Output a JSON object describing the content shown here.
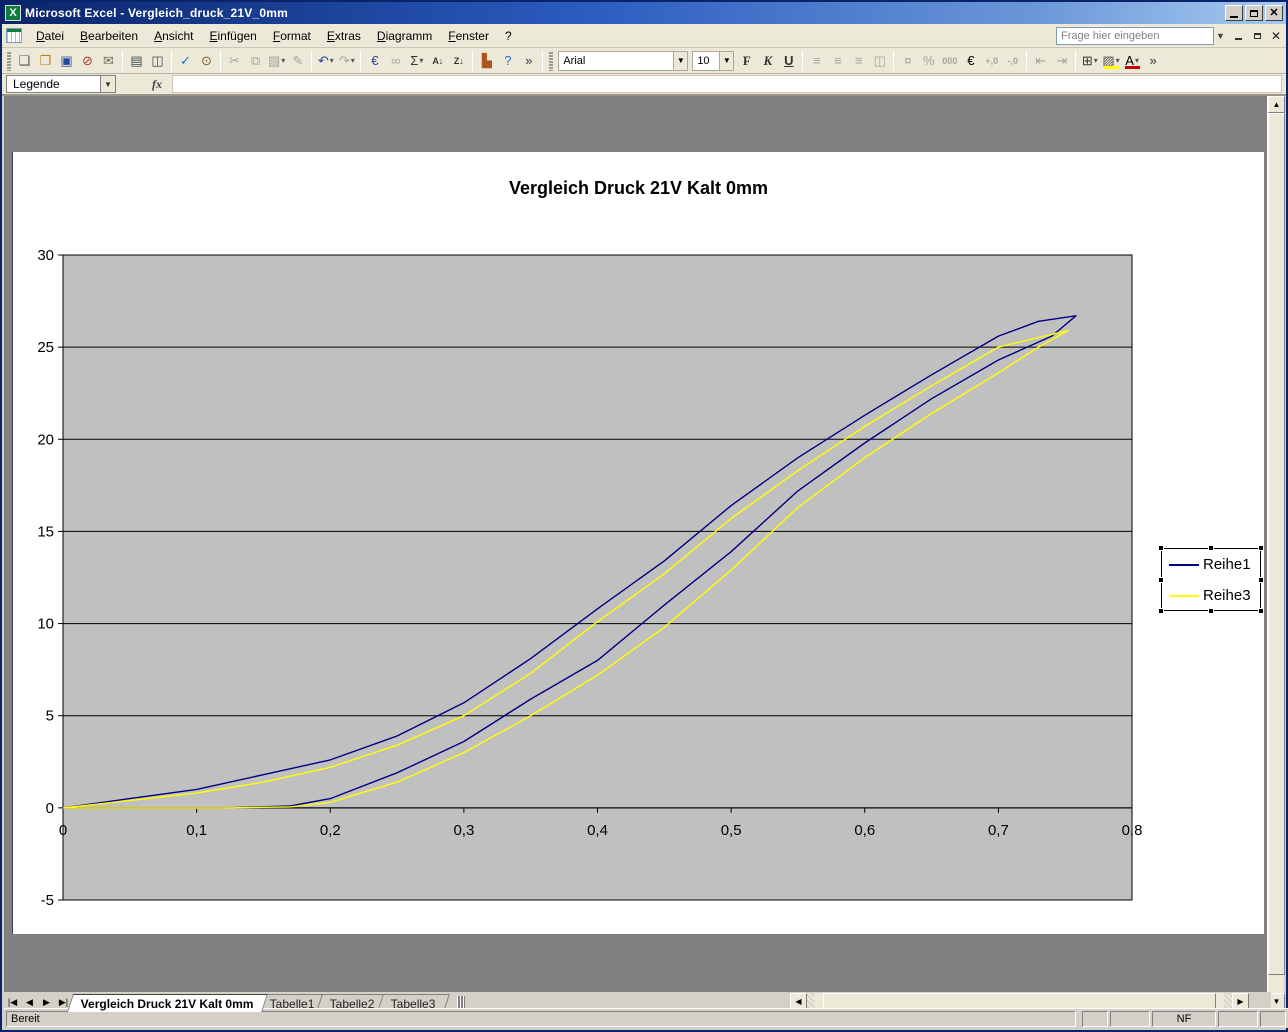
{
  "titlebar": {
    "title": "Microsoft Excel - Vergleich_druck_21V_0mm"
  },
  "menubar": {
    "items": [
      "Datei",
      "Bearbeiten",
      "Ansicht",
      "Einfügen",
      "Format",
      "Extras",
      "Diagramm",
      "Fenster",
      "?"
    ],
    "question_placeholder": "Frage hier eingeben"
  },
  "standard_toolbar": {
    "buttons": [
      {
        "name": "new-button",
        "glyph": "❑",
        "color": "#555"
      },
      {
        "name": "open-button",
        "glyph": "❒",
        "color": "#b8860b"
      },
      {
        "name": "save-button",
        "glyph": "▣",
        "color": "#23479e"
      },
      {
        "name": "permission-button",
        "glyph": "⊘",
        "color": "#b03030"
      },
      {
        "name": "mail-button",
        "glyph": "✉",
        "color": "#6b6b5a"
      },
      {
        "name": "print-button",
        "glyph": "▤",
        "color": "#3c4d5a",
        "sep": true
      },
      {
        "name": "print-preview-button",
        "glyph": "◫",
        "color": "#3c4d5a"
      },
      {
        "name": "spelling-button",
        "glyph": "✓",
        "color": "#1f6fc0",
        "sep": true
      },
      {
        "name": "research-button",
        "glyph": "⊙",
        "color": "#7a5c28"
      },
      {
        "name": "cut-button",
        "glyph": "✂",
        "dim": true,
        "sep": true
      },
      {
        "name": "copy-button",
        "glyph": "⧉",
        "dim": true
      },
      {
        "name": "paste-button",
        "glyph": "▨",
        "dim": true,
        "dropdown": true
      },
      {
        "name": "format-painter-button",
        "glyph": "✎",
        "dim": true
      },
      {
        "name": "undo-button",
        "glyph": "↶",
        "color": "#23479e",
        "dropdown": true,
        "sep": true
      },
      {
        "name": "redo-button",
        "glyph": "↷",
        "dim": true,
        "dropdown": true
      },
      {
        "name": "euro-convert-button",
        "glyph": "€",
        "color": "#23479e",
        "sep": true
      },
      {
        "name": "hyperlink-button",
        "glyph": "∞",
        "dim": true
      },
      {
        "name": "autosum-button",
        "glyph": "Σ",
        "color": "#333",
        "dropdown": true
      },
      {
        "name": "sort-ascending-button",
        "glyph": "A↓",
        "small": true,
        "color": "#333"
      },
      {
        "name": "sort-descending-button",
        "glyph": "Z↓",
        "small": true,
        "color": "#333"
      },
      {
        "name": "chart-wizard-button",
        "glyph": "▙",
        "color": "#b0541e",
        "sep": true
      },
      {
        "name": "help-button",
        "glyph": "?",
        "color": "#1f6fc0"
      },
      {
        "name": "toolbar-options-button",
        "glyph": "»",
        "color": "#333"
      }
    ]
  },
  "formatting_toolbar": {
    "font_name": "Arial",
    "font_size": "10",
    "buttons": [
      {
        "name": "bold-button",
        "glyph": "F",
        "cls": "fmt-b"
      },
      {
        "name": "italic-button",
        "glyph": "K",
        "cls": "fmt-i"
      },
      {
        "name": "underline-button",
        "glyph": "U",
        "cls": "fmt-u"
      },
      {
        "name": "align-left-button",
        "glyph": "≡",
        "dim": true,
        "sep": true
      },
      {
        "name": "align-center-button",
        "glyph": "≡",
        "dim": true
      },
      {
        "name": "align-right-button",
        "glyph": "≡",
        "dim": true
      },
      {
        "name": "merge-center-button",
        "glyph": "◫",
        "dim": true
      },
      {
        "name": "currency-button",
        "glyph": "¤",
        "dim": true,
        "sep": true
      },
      {
        "name": "percent-button",
        "glyph": "%",
        "dim": true
      },
      {
        "name": "thousands-button",
        "glyph": "000",
        "small": true,
        "dim": true
      },
      {
        "name": "euro-button",
        "glyph": "€",
        "color": "#000"
      },
      {
        "name": "increase-decimal-button",
        "glyph": "+,0",
        "small": true,
        "dim": true
      },
      {
        "name": "decrease-decimal-button",
        "glyph": "-,0",
        "small": true,
        "dim": true
      },
      {
        "name": "decrease-indent-button",
        "glyph": "⇤",
        "dim": true,
        "sep": true
      },
      {
        "name": "increase-indent-button",
        "glyph": "⇥",
        "dim": true
      },
      {
        "name": "borders-button",
        "glyph": "⊞",
        "color": "#333",
        "dropdown": true,
        "sep": true
      },
      {
        "name": "fill-color-button",
        "glyph": "▨",
        "color": "#555",
        "cls": "bar-fill",
        "dropdown": true
      },
      {
        "name": "font-color-button",
        "glyph": "A",
        "color": "#000",
        "cls": "bar-fcol",
        "dropdown": true
      },
      {
        "name": "toolbar-options2-button",
        "glyph": "»",
        "color": "#333"
      }
    ]
  },
  "formula_bar": {
    "name_box": "Legende",
    "fx_label": "fx",
    "formula_value": ""
  },
  "chart_data": {
    "type": "line",
    "title": "Vergleich Druck 21V Kalt 0mm",
    "xlabel": "",
    "ylabel": "",
    "xlim": [
      0,
      0.8
    ],
    "ylim": [
      -5,
      30
    ],
    "grid": "horizontal",
    "legend_position": "right",
    "plot_bg": "#C0C0C0",
    "xticks": {
      "values": [
        0,
        0.1,
        0.2,
        0.3,
        0.4,
        0.5,
        0.6,
        0.7,
        0.8
      ],
      "labels": [
        "0",
        "0,1",
        "0,2",
        "0,3",
        "0,4",
        "0,5",
        "0,6",
        "0,7",
        "0,8"
      ]
    },
    "yticks": {
      "values": [
        30,
        25,
        20,
        15,
        10,
        5,
        0,
        -5
      ],
      "labels": [
        "30",
        "25",
        "20",
        "15",
        "10",
        "5",
        "0",
        "-5"
      ]
    },
    "series": [
      {
        "name": "Reihe1",
        "color": "#000080",
        "x": [
          0,
          0.05,
          0.1,
          0.15,
          0.2,
          0.25,
          0.3,
          0.35,
          0.4,
          0.45,
          0.5,
          0.55,
          0.6,
          0.65,
          0.7,
          0.73,
          0.758,
          0.74,
          0.7,
          0.65,
          0.6,
          0.55,
          0.5,
          0.45,
          0.4,
          0.35,
          0.3,
          0.25,
          0.2,
          0.17,
          0.12,
          0.05,
          0
        ],
        "y": [
          0,
          0.5,
          1.0,
          1.8,
          2.6,
          3.9,
          5.7,
          8.1,
          10.8,
          13.4,
          16.4,
          19.0,
          21.3,
          23.5,
          25.6,
          26.4,
          26.7,
          25.6,
          24.3,
          22.2,
          19.8,
          17.2,
          13.9,
          11.0,
          8.0,
          5.9,
          3.6,
          1.9,
          0.5,
          0.1,
          0,
          0,
          0
        ]
      },
      {
        "name": "Reihe3",
        "color": "#FFFF00",
        "x": [
          0,
          0.05,
          0.1,
          0.15,
          0.2,
          0.25,
          0.3,
          0.35,
          0.4,
          0.45,
          0.5,
          0.55,
          0.6,
          0.65,
          0.7,
          0.752,
          0.73,
          0.7,
          0.65,
          0.6,
          0.55,
          0.5,
          0.45,
          0.4,
          0.35,
          0.3,
          0.25,
          0.2,
          0.17,
          0.12,
          0.05,
          0
        ],
        "y": [
          0,
          0.4,
          0.8,
          1.4,
          2.2,
          3.4,
          5.0,
          7.3,
          10.1,
          12.7,
          15.7,
          18.3,
          20.7,
          22.9,
          25.0,
          25.9,
          25.0,
          23.6,
          21.4,
          19.0,
          16.3,
          12.9,
          9.8,
          7.2,
          5.0,
          3.0,
          1.4,
          0.3,
          0.05,
          0,
          0,
          0
        ]
      }
    ]
  },
  "sheet_tabs": {
    "nav": [
      "|◀",
      "◀",
      "▶",
      "▶|"
    ],
    "tabs": [
      {
        "label": "Vergleich Druck 21V Kalt 0mm",
        "active": true
      },
      {
        "label": "Tabelle1",
        "active": false
      },
      {
        "label": "Tabelle2",
        "active": false
      },
      {
        "label": "Tabelle3",
        "active": false
      }
    ]
  },
  "status_bar": {
    "mode": "Bereit",
    "panels": [
      "",
      "",
      "NF",
      "",
      ""
    ]
  }
}
